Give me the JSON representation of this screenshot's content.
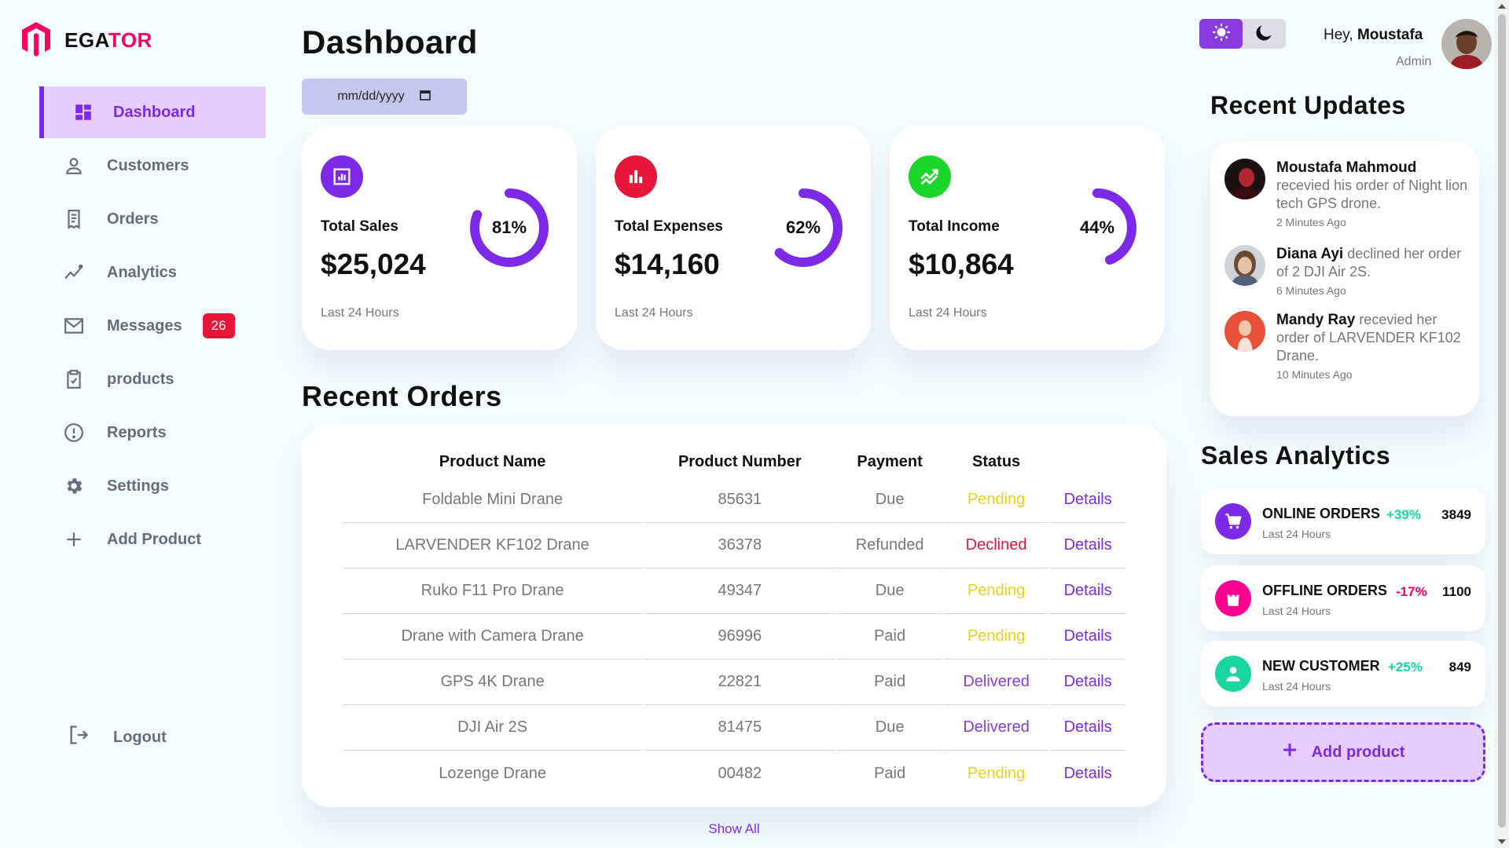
{
  "brand": {
    "name_prefix": "EGA",
    "name_accent": "TOR",
    "accent_color": "#ff0060"
  },
  "sidebar": {
    "items": [
      {
        "label": "Dashboard",
        "icon": "grid-icon",
        "active": true
      },
      {
        "label": "Customers",
        "icon": "person-icon"
      },
      {
        "label": "Orders",
        "icon": "receipt-icon"
      },
      {
        "label": "Analytics",
        "icon": "insights-icon"
      },
      {
        "label": "Messages",
        "icon": "mail-icon",
        "badge": "26"
      },
      {
        "label": "products",
        "icon": "clipboard-check-icon"
      },
      {
        "label": "Reports",
        "icon": "alert-circle-icon"
      },
      {
        "label": "Settings",
        "icon": "gear-icon"
      },
      {
        "label": "Add Product",
        "icon": "plus-icon"
      }
    ],
    "logout_label": "Logout"
  },
  "header": {
    "title": "Dashboard",
    "date_placeholder": "mm/dd/yyyy",
    "greeting_prefix": "Hey, ",
    "user_name": "Moustafa",
    "user_role": "Admin",
    "theme": "light"
  },
  "insights": [
    {
      "title": "Total Sales",
      "value": "$25,024",
      "percent_label": "81%",
      "percent": 81,
      "footer": "Last 24 Hours",
      "icon": "bar-chart-icon",
      "icon_bg": "#7c2ae8"
    },
    {
      "title": "Total Expenses",
      "value": "$14,160",
      "percent_label": "62%",
      "percent": 62,
      "footer": "Last 24 Hours",
      "icon": "bars-icon",
      "icon_bg": "#e8173a"
    },
    {
      "title": "Total Income",
      "value": "$10,864",
      "percent_label": "44%",
      "percent": 44,
      "footer": "Last 24 Hours",
      "icon": "trending-up-icon",
      "icon_bg": "#1ad62a"
    }
  ],
  "orders": {
    "title": "Recent Orders",
    "headers": [
      "Product Name",
      "Product Number",
      "Payment",
      "Status"
    ],
    "rows": [
      {
        "name": "Foldable Mini Drane",
        "number": "85631",
        "payment": "Due",
        "status": "Pending",
        "action": "Details"
      },
      {
        "name": "LARVENDER KF102 Drane",
        "number": "36378",
        "payment": "Refunded",
        "status": "Declined",
        "action": "Details"
      },
      {
        "name": "Ruko F11 Pro Drane",
        "number": "49347",
        "payment": "Due",
        "status": "Pending",
        "action": "Details"
      },
      {
        "name": "Drane with Camera Drane",
        "number": "96996",
        "payment": "Paid",
        "status": "Pending",
        "action": "Details"
      },
      {
        "name": "GPS 4K Drane",
        "number": "22821",
        "payment": "Paid",
        "status": "Delivered",
        "action": "Details"
      },
      {
        "name": "DJI Air 2S",
        "number": "81475",
        "payment": "Due",
        "status": "Delivered",
        "action": "Details"
      },
      {
        "name": "Lozenge Drane",
        "number": "00482",
        "payment": "Paid",
        "status": "Pending",
        "action": "Details"
      }
    ],
    "show_all": "Show All"
  },
  "recent_updates": {
    "title": "Recent Updates",
    "items": [
      {
        "name": "Moustafa Mahmoud",
        "text": " recevied his order of Night lion tech GPS drone.",
        "time": "2 Minutes Ago"
      },
      {
        "name": "Diana Ayi",
        "text": " declined her order of 2 DJI Air 2S.",
        "time": "6 Minutes Ago"
      },
      {
        "name": "Mandy Ray",
        "text": " recevied her order of LARVENDER KF102 Drane.",
        "time": "10 Minutes Ago"
      }
    ]
  },
  "sales_analytics": {
    "title": "Sales Analytics",
    "items": [
      {
        "label": "ONLINE ORDERS",
        "change": "+39%",
        "count": "3849",
        "footer": "Last 24 Hours",
        "icon": "cart-icon",
        "icon_bg": "#7c2ae8",
        "change_color": "#1bd5a0"
      },
      {
        "label": "OFFLINE ORDERS",
        "change": "-17%",
        "count": "1100",
        "footer": "Last 24 Hours",
        "icon": "shopping-bag-icon",
        "icon_bg": "#ff0090",
        "change_color": "#ff0060"
      },
      {
        "label": "NEW CUSTOMER",
        "change": "+25%",
        "count": "849",
        "footer": "Last 24 Hours",
        "icon": "person-icon",
        "icon_bg": "#1bd5a0",
        "change_color": "#1bd5a0"
      }
    ],
    "add_label": "Add product"
  }
}
